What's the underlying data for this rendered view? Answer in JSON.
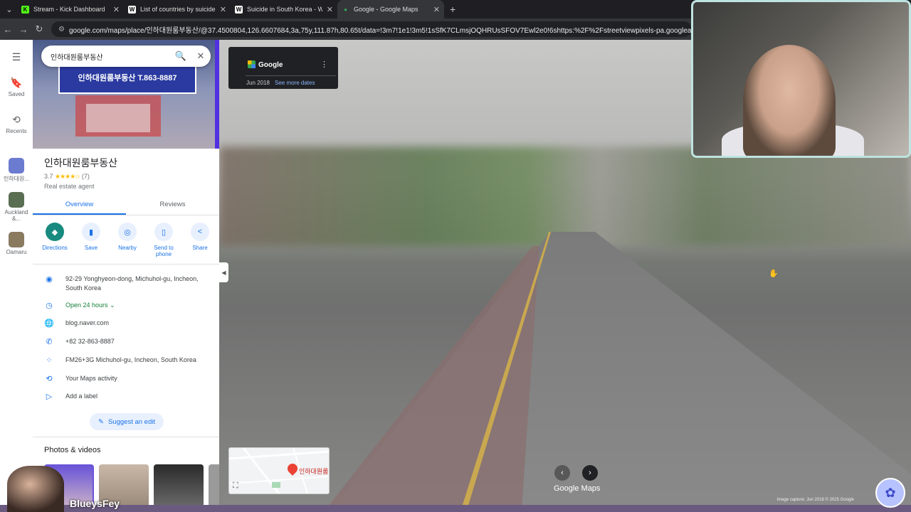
{
  "browser": {
    "tabs": [
      {
        "title": "Stream - Kick Dashboard",
        "fav": "K",
        "favColor": "#53fc18"
      },
      {
        "title": "List of countries by suicide rate",
        "fav": "W",
        "favColor": "#ffffff"
      },
      {
        "title": "Suicide in South Korea - Wikipe",
        "fav": "W",
        "favColor": "#ffffff"
      },
      {
        "title": "Google - Google Maps",
        "fav": "●",
        "favColor": "#34a853"
      }
    ],
    "url": "google.com/maps/place/인하대원룸부동산/@37.4500804,126.6607684,3a,75y,111.87h,80.65t/data=!3m7!1e1!3m5!1sSfK7CLmsjOQHRUsSFOV7Ewl2e0!6shttps:%2F%2Fstreetviewpixels-pa.googleapis.com%2Fv1%2Fthumb"
  },
  "rail": {
    "saved": "Saved",
    "recents": "Recents",
    "recent1": "인하대원...",
    "recent2": "Auckland &...",
    "recent3": "Oamaru"
  },
  "place": {
    "search": "인하대원룸부동산",
    "hero_sign": "인하대원룸부동산  T.863-8887",
    "name": "인하대원룸부동산",
    "rating": "3.7",
    "stars": "★★★★☆",
    "reviews": "(7)",
    "type": "Real estate agent",
    "tab_overview": "Overview",
    "tab_reviews": "Reviews",
    "actions": [
      {
        "label": "Directions",
        "icon": "◆"
      },
      {
        "label": "Save",
        "icon": "🔖"
      },
      {
        "label": "Nearby",
        "icon": "◎"
      },
      {
        "label": "Send to phone",
        "icon": "▯"
      },
      {
        "label": "Share",
        "icon": "<"
      }
    ],
    "address": "92-29 Yonghyeon-dong, Michuhol-gu, Incheon, South Korea",
    "hours": "Open 24 hours",
    "website": "blog.naver.com",
    "phone": "+82 32-863-8887",
    "pluscode": "FM26+3G Michuhol-gu, Incheon, South Korea",
    "activity": "Your Maps activity",
    "label": "Add a label",
    "suggest": "Suggest an edit",
    "photos": "Photos & videos"
  },
  "streetview": {
    "brand": "Google",
    "date": "Jun 2018",
    "more": "See more dates",
    "minimap_label": "인하대원룸",
    "logo": "Google Maps",
    "footer": "Image capture: Jun 2018   © 2025 Google"
  },
  "overlay": {
    "streamer": "BlueysFey"
  }
}
